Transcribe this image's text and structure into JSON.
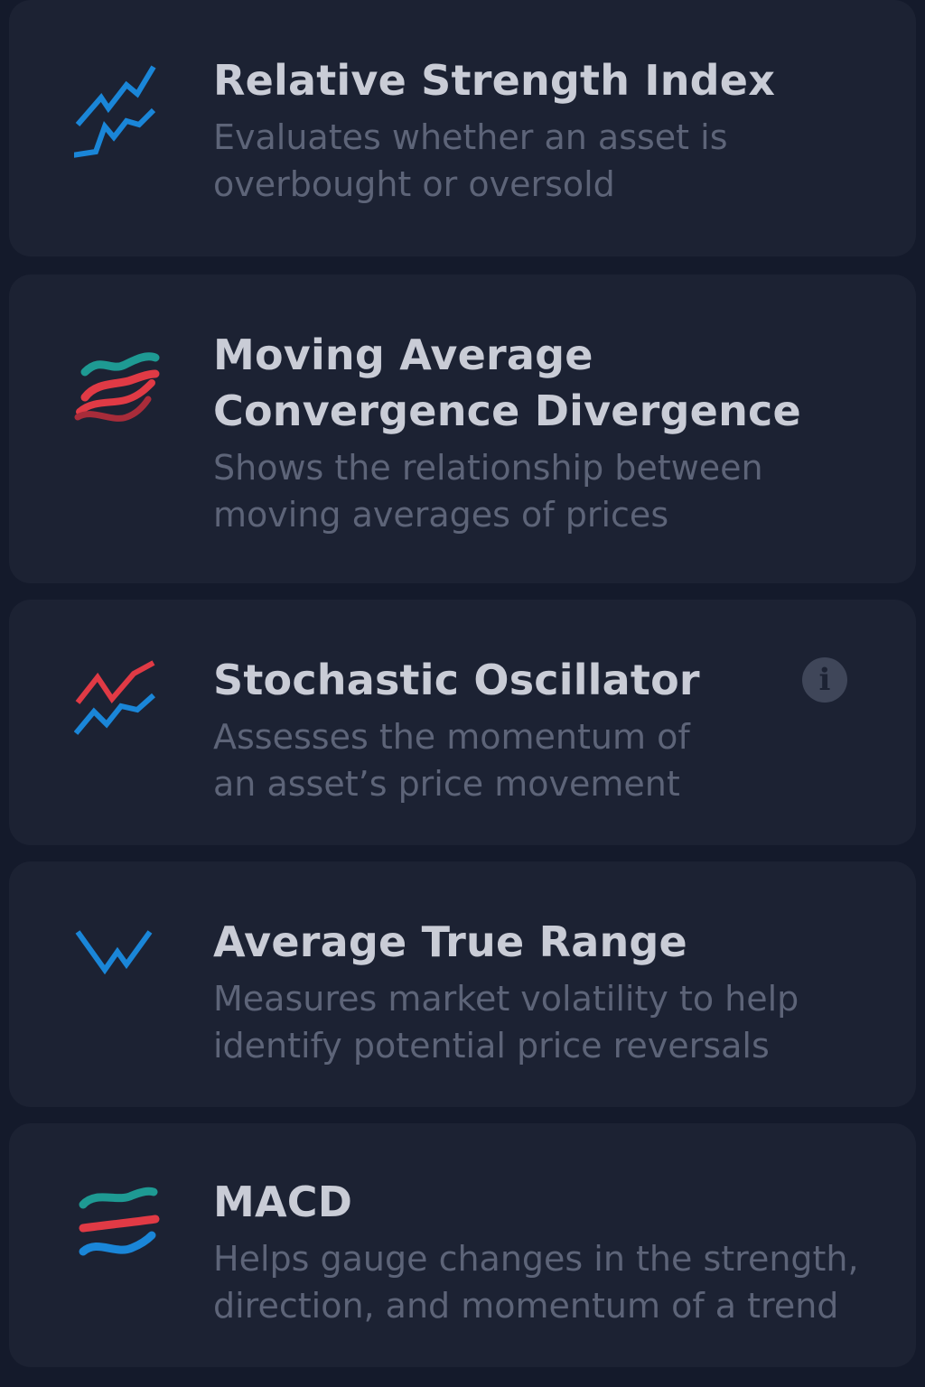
{
  "colors": {
    "background": "#141a2b",
    "card": "#1c2233",
    "title": "#c9ccd6",
    "description": "#5d6478",
    "blue": "#1a86d8",
    "red": "#e03a45",
    "teal": "#1e9a93"
  },
  "indicators": [
    {
      "icon": "rsi-line-chart-icon",
      "title": "Relative Strength Index",
      "description": "Evaluates whether an asset is\noverbought or oversold"
    },
    {
      "icon": "macd-wave-lines-icon",
      "title": "Moving Average Convergence Divergence",
      "description": "Shows the relationship between\nmoving averages of prices"
    },
    {
      "icon": "stochastic-line-chart-icon",
      "title": "Stochastic Oscillator",
      "description": "Assesses the momentum of\nan asset’s price movement",
      "info_icon": "i"
    },
    {
      "icon": "atr-zigzag-icon",
      "title": "Average True Range",
      "description": "Measures market volatility to  help\nidentify potential price reversals"
    },
    {
      "icon": "macd-wave-lines-icon",
      "title": "MACD",
      "description": "Helps gauge changes in the strength,\ndirection, and momentum of a trend"
    }
  ]
}
